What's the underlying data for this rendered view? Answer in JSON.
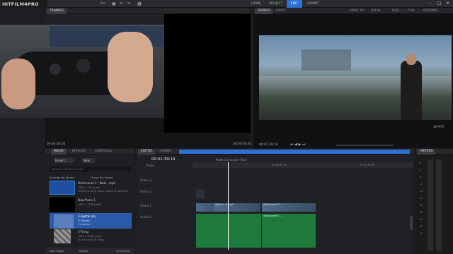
{
  "app": {
    "title": "HITFILM4PRO",
    "menu_file": "File"
  },
  "workspaces": [
    "HOME",
    "PROJECT",
    "EDIT",
    "EXPORT"
  ],
  "trimmer": {
    "tab": "TRIMMER",
    "time_in": "00:00:00:00",
    "time_out": "00:00:00:00"
  },
  "viewer": {
    "tabs": [
      "VIEWER",
      "LAYER"
    ],
    "view": "VIEW: 3D",
    "coord": "LOCAL",
    "channel": "RGB",
    "zoom": "FULL",
    "options": "OPTIONS",
    "time": "00:01:39:19",
    "fps": "29.970"
  },
  "media": {
    "tabs": [
      "MEDIA",
      "EFFECTS",
      "CONTROLS"
    ],
    "import": "Import...",
    "new": "New",
    "search": "Search in Project Media",
    "arrange": "Arrange By: Name",
    "group": "Group By: Folder",
    "items": [
      {
        "name": "Dishonored 2 - Walk...mp4",
        "sub1": "1280 x 720 pixels",
        "sub2": "00:09:46:16 @ 30fps, stereo @ 48000Hz"
      },
      {
        "name": "New Plane 1",
        "sub1": "1920 x 1080 pixels",
        "sub2": ""
      },
      {
        "name": "3-Fighter.obj",
        "sub1": "3D Model",
        "sub2": "3 meshes"
      },
      {
        "name": "3-Thing",
        "sub1": "1920 x 1080 pixels",
        "sub2": "00:00:10:00 @ 30fps"
      }
    ],
    "new_folder": "New Folder",
    "delete": "Delete",
    "count": "10 Item(s)"
  },
  "editor": {
    "tabs": [
      "EDITOR",
      "3 NEWS"
    ],
    "timecode": "00:01:39:19",
    "make_composite": "Make Composite Shot",
    "tracks_label": "Tracks",
    "tracks": [
      "Video 3",
      "Video 2",
      "Video 1",
      "Audio 1"
    ],
    "ruler": [
      "00:00:45:00",
      "00:01:30:00",
      "00:02:15:00"
    ],
    "clips": [
      "dishon...d.mp4",
      "dishonored 2 - ...",
      "dishonored 2 - ..."
    ]
  },
  "meters": {
    "title": "METERS",
    "scale": [
      "6",
      "0",
      "-6",
      "-12",
      "-18",
      "-24",
      "-30",
      "-36",
      "-42",
      "-48",
      "-54"
    ]
  },
  "colors": {
    "accent": "#2f6fd1",
    "audio": "#1d7a3a",
    "video": "#4e6a86"
  }
}
